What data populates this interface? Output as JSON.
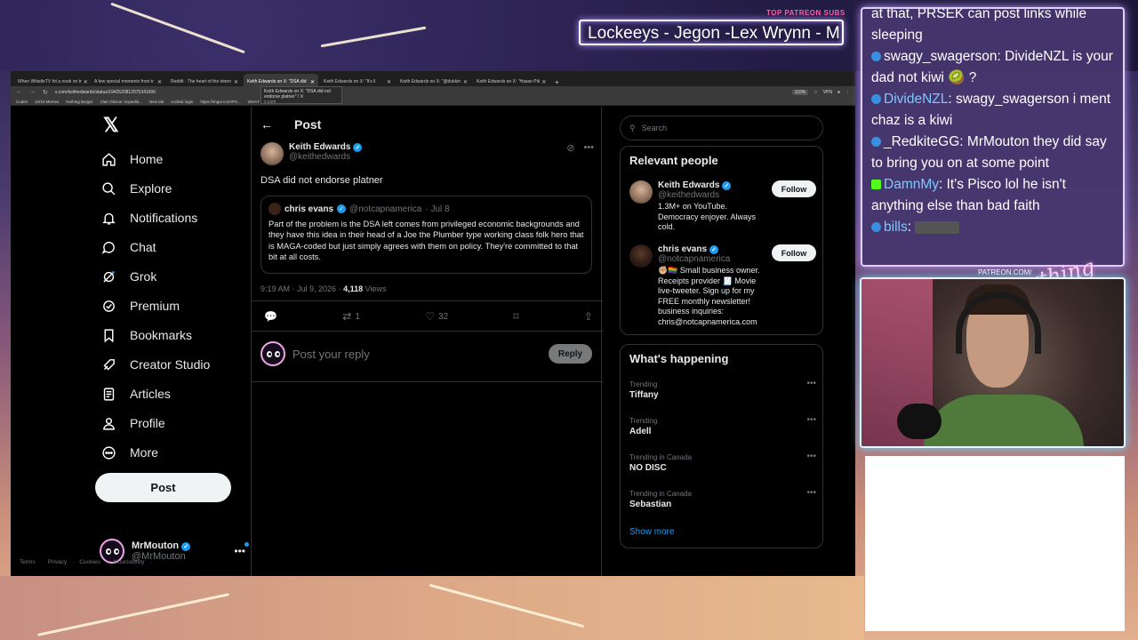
{
  "stream": {
    "subs_label": "TOP PATREON SUBS",
    "subs_ticker": "Lockeeys - Jegon -Lex Wrynn -  M",
    "patreon_url": "PATREON.COM/",
    "logo_text": "AnythingElse"
  },
  "browser": {
    "tabs": [
      {
        "label": "When WhistleTV hit a nook on tr"
      },
      {
        "label": "A few special moments from tr"
      },
      {
        "label": "Reddit - The heart of the intern"
      },
      {
        "label": "Keith Edwards on X: \"DSA did"
      },
      {
        "label": "Keith Edwards on X: \"It's li"
      },
      {
        "label": "Keith Edwards on X: \"@dukkin"
      },
      {
        "label": "Keith Edwards on X: \"Hasan Pik"
      }
    ],
    "url": "x.com/keithedwards/status/1942520812975341000",
    "zoom": "110%",
    "vpn": "VPN",
    "bookmarks": [
      "Codes",
      "10/10 Memes",
      "Nothing Burger",
      "Clair Obscur: Expediti...",
      "New tab",
      "ecdesk login",
      "https://imgur.com/PS...",
      "WHAT SLOP TO LEARN"
    ],
    "tooltip_title": "Keith Edwards on X: \"DSA did not endorse platner\" / X",
    "tooltip_sub": "x.com"
  },
  "nav": {
    "items": [
      {
        "label": "Home",
        "icon": "home-icon"
      },
      {
        "label": "Explore",
        "icon": "search-icon"
      },
      {
        "label": "Notifications",
        "icon": "bell-icon"
      },
      {
        "label": "Chat",
        "icon": "chat-icon"
      },
      {
        "label": "Grok",
        "icon": "grok-icon"
      },
      {
        "label": "Premium",
        "icon": "premium-icon"
      },
      {
        "label": "Bookmarks",
        "icon": "bookmark-icon"
      },
      {
        "label": "Creator Studio",
        "icon": "rocket-icon"
      },
      {
        "label": "Articles",
        "icon": "articles-icon"
      },
      {
        "label": "Profile",
        "icon": "person-icon"
      },
      {
        "label": "More",
        "icon": "more-circle-icon"
      }
    ],
    "post_label": "Post",
    "account_name": "MrMouton",
    "account_handle": "@MrMouton"
  },
  "post": {
    "header_title": "Post",
    "author_name": "Keith Edwards",
    "author_handle": "@keithedwards",
    "text": "DSA did not endorse platner",
    "quote": {
      "name": "chris evans",
      "handle": "@notcapnamerica",
      "date": "· Jul 8",
      "text": "Part of the problem is the DSA left comes from privileged economic backgrounds and they have this idea in their head of a Joe the Plumber type working class folk hero that is MAGA-coded but just simply agrees with them on policy. They're committed to that bit at all costs."
    },
    "timestamp": "9:19 AM · Jul 9, 2026 · ",
    "views_count": "4,118",
    "views_label": " Views",
    "reposts": "1",
    "likes": "32",
    "reply_placeholder": "Post your reply",
    "reply_button": "Reply"
  },
  "sidebar": {
    "search_placeholder": "Search",
    "relevant_title": "Relevant people",
    "people": [
      {
        "name": "Keith Edwards",
        "handle": "@keithedwards",
        "bio": "1.3M+ on YouTube. Democracy enjoyer. Always cold.",
        "follow": "Follow"
      },
      {
        "name": "chris evans",
        "handle": "@notcapnamerica",
        "bio": "✊🏼🏳️‍🌈 Small business owner. Receipts provider 🧾 Movie live-tweeter. Sign up for my FREE monthly newsletter! business inquiries: chris@notcapnamerica.com",
        "follow": "Follow"
      }
    ],
    "happening_title": "What's happening",
    "trends": [
      {
        "context": "Trending",
        "name": "Tiffany"
      },
      {
        "context": "Trending",
        "name": "Adell"
      },
      {
        "context": "Trending in Canada",
        "name": "NO DISC"
      },
      {
        "context": "Trending in Canada",
        "name": "Sebastian"
      }
    ],
    "show_more": "Show more",
    "footer": [
      "Terms",
      "·",
      "Privacy",
      "·",
      "Cookies",
      "·",
      "Accessibility",
      "·"
    ]
  },
  "chat": {
    "messages": [
      {
        "user": "",
        "text": "at that, PRSEK can post links while sleeping"
      },
      {
        "user": "swagy_swagerson",
        "text": ": DivideNZL is your dad not kiwi 🥝 ?"
      },
      {
        "user": "DivideNZL",
        "text": ": swagy_swagerson i ment chaz is a kiwi"
      },
      {
        "user": "_RedkiteGG",
        "text": ": MrMouton they did say to bring you on at some point"
      },
      {
        "user": "DamnMy",
        "text": ": It's Pisco lol he isn't anything else than bad faith"
      },
      {
        "user": "bills",
        "text": ": "
      }
    ]
  },
  "colors": {
    "accent": "#1d9bf0",
    "background": "#000000",
    "text": "#e7e9ea",
    "muted": "#71767b"
  }
}
